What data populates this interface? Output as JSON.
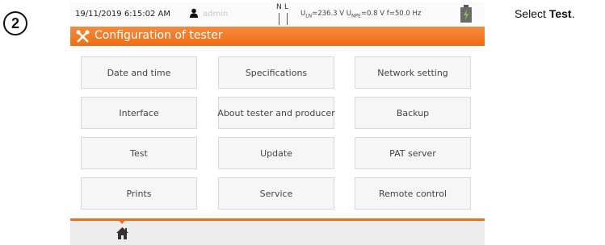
{
  "step": {
    "number": "2"
  },
  "instruction": {
    "prefix": "Select ",
    "target": "Test",
    "suffix": "."
  },
  "status_bar": {
    "datetime": "19/11/2019 6:15:02 AM",
    "user_icon": "user-icon",
    "username": "admin",
    "n_label": "N",
    "l_label": "L",
    "u_ln_label": "U",
    "u_ln_sub": "LN",
    "u_ln_value": "=236.3 V",
    "u_npe_label": "U",
    "u_npe_sub": "NPE",
    "u_npe_value": "=0.8 V",
    "frequency": "f=50.0 Hz",
    "battery_icon": "battery-icon"
  },
  "title_bar": {
    "icon": "tools-icon",
    "title": "Configuration of tester"
  },
  "menu": {
    "buttons": [
      "Date and time",
      "Specifications",
      "Network setting",
      "Interface",
      "About tester and producer",
      "Backup",
      "Test",
      "Update",
      "PAT server",
      "Prints",
      "Service",
      "Remote control"
    ]
  },
  "bottom_bar": {
    "home_icon": "home-icon"
  },
  "colors": {
    "accent": "#ef6d16",
    "title_text": "#ffffff",
    "button_bg": "#f6f6f6"
  }
}
